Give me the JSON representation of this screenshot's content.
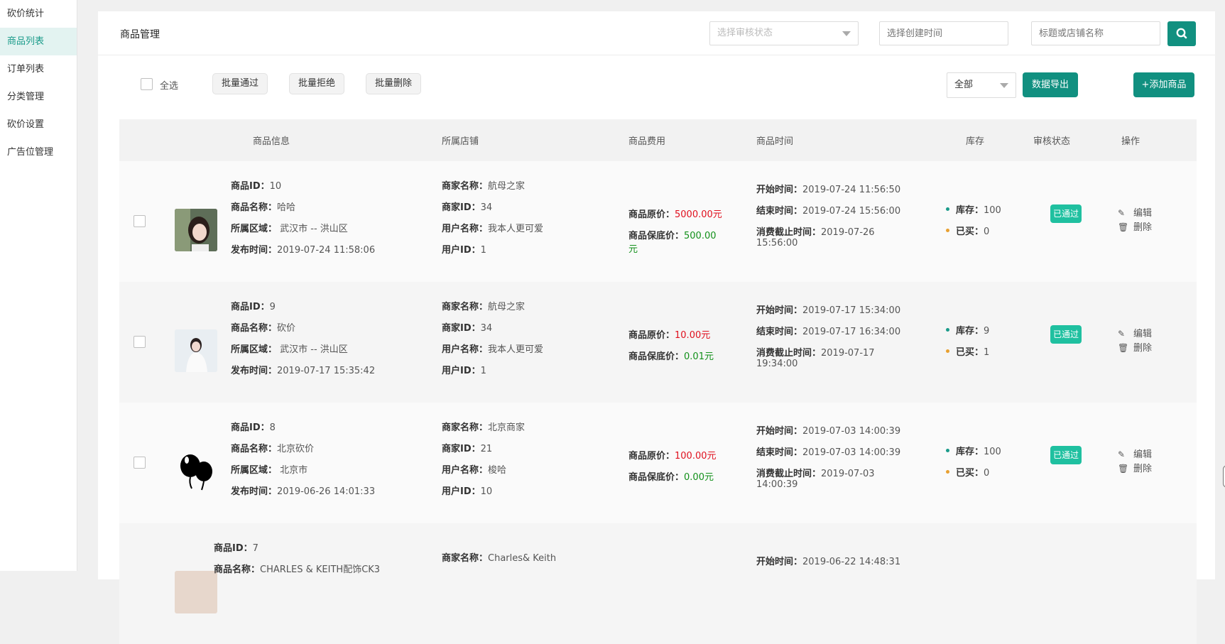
{
  "sidebar": {
    "items": [
      {
        "label": "砍价统计"
      },
      {
        "label": "商品列表"
      },
      {
        "label": "订单列表"
      },
      {
        "label": "分类管理"
      },
      {
        "label": "砍价设置"
      },
      {
        "label": "广告位管理"
      }
    ],
    "active_index": 1
  },
  "header": {
    "title": "商品管理",
    "status_select_placeholder": "选择审核状态",
    "date_input_placeholder": "选择创建时间",
    "keyword_input_placeholder": "标题或店铺名称",
    "search_icon": "search-icon"
  },
  "toolbar": {
    "select_all_label": "全选",
    "batch_approve": "批量通过",
    "batch_reject": "批量拒绝",
    "batch_delete": "批量删除",
    "filter_value": "全部",
    "export_label": "数据导出",
    "add_label": "+添加商品"
  },
  "table": {
    "headers": {
      "info": "商品信息",
      "shop": "所属店铺",
      "fee": "商品费用",
      "time": "商品时间",
      "stock": "库存",
      "status": "审核状态",
      "ops": "操作"
    },
    "labels": {
      "id": "商品ID：",
      "name": "商品名称：",
      "area": "所属区域：",
      "publish": "发布时间：",
      "merchant_name": "商家名称：",
      "merchant_id": "商家ID：",
      "user_name": "用户名称：",
      "user_id": "用户ID：",
      "orig_price": "商品原价：",
      "floor_price": "商品保底价：",
      "start": "开始时间：",
      "end": "结束时间：",
      "deadline": "消费截止时间：",
      "stock": "库存：",
      "bought": "已买：",
      "edit": "编辑",
      "delete": "删除"
    },
    "rows": [
      {
        "id": "10",
        "name": "哈哈",
        "area": " 武汉市 -- 洪山区",
        "publish": "2019-07-24 11:58:06",
        "merchant_name": "航母之家",
        "merchant_id": "34",
        "user_name": "我本人更可爱",
        "user_id": "1",
        "orig_price": "5000.00元",
        "floor_price_line1": "500.00",
        "floor_price_line2": "元",
        "start": "2019-07-24 11:56:50",
        "end": "2019-07-24 15:56:00",
        "deadline_line1": "2019-07-26",
        "deadline_line2": "15:56:00",
        "stock": "100",
        "bought": "0",
        "status": "已通过"
      },
      {
        "id": "9",
        "name": "砍价",
        "area": " 武汉市 -- 洪山区",
        "publish": "2019-07-17 15:35:42",
        "merchant_name": "航母之家",
        "merchant_id": "34",
        "user_name": "我本人更可爱",
        "user_id": "1",
        "orig_price": "10.00元",
        "floor_price": "0.01元",
        "start": "2019-07-17 15:34:00",
        "end": "2019-07-17 16:34:00",
        "deadline_line1": "2019-07-17",
        "deadline_line2": "19:34:00",
        "stock": "9",
        "bought": "1",
        "status": "已通过"
      },
      {
        "id": "8",
        "name": "北京砍价",
        "area": " 北京市",
        "publish": "2019-06-26 14:01:33",
        "merchant_name": "北京商家",
        "merchant_id": "21",
        "user_name": "梭哈",
        "user_id": "10",
        "orig_price": "100.00元",
        "floor_price": "0.00元",
        "start": "2019-07-03 14:00:39",
        "end": "2019-07-03 14:00:39",
        "deadline_line1": "2019-07-03",
        "deadline_line2": "14:00:39",
        "stock": "100",
        "bought": "0",
        "status": "已通过"
      },
      {
        "id": "7",
        "name_partial": "CHARLES & KEITH配饰CK3",
        "merchant_name": "Charles& Keith",
        "start": "2019-06-22 14:48:31"
      }
    ]
  },
  "colors": {
    "accent": "#119080",
    "badge": "#1fc0a0",
    "price_red": "#e0101e",
    "price_green": "#12901a"
  }
}
